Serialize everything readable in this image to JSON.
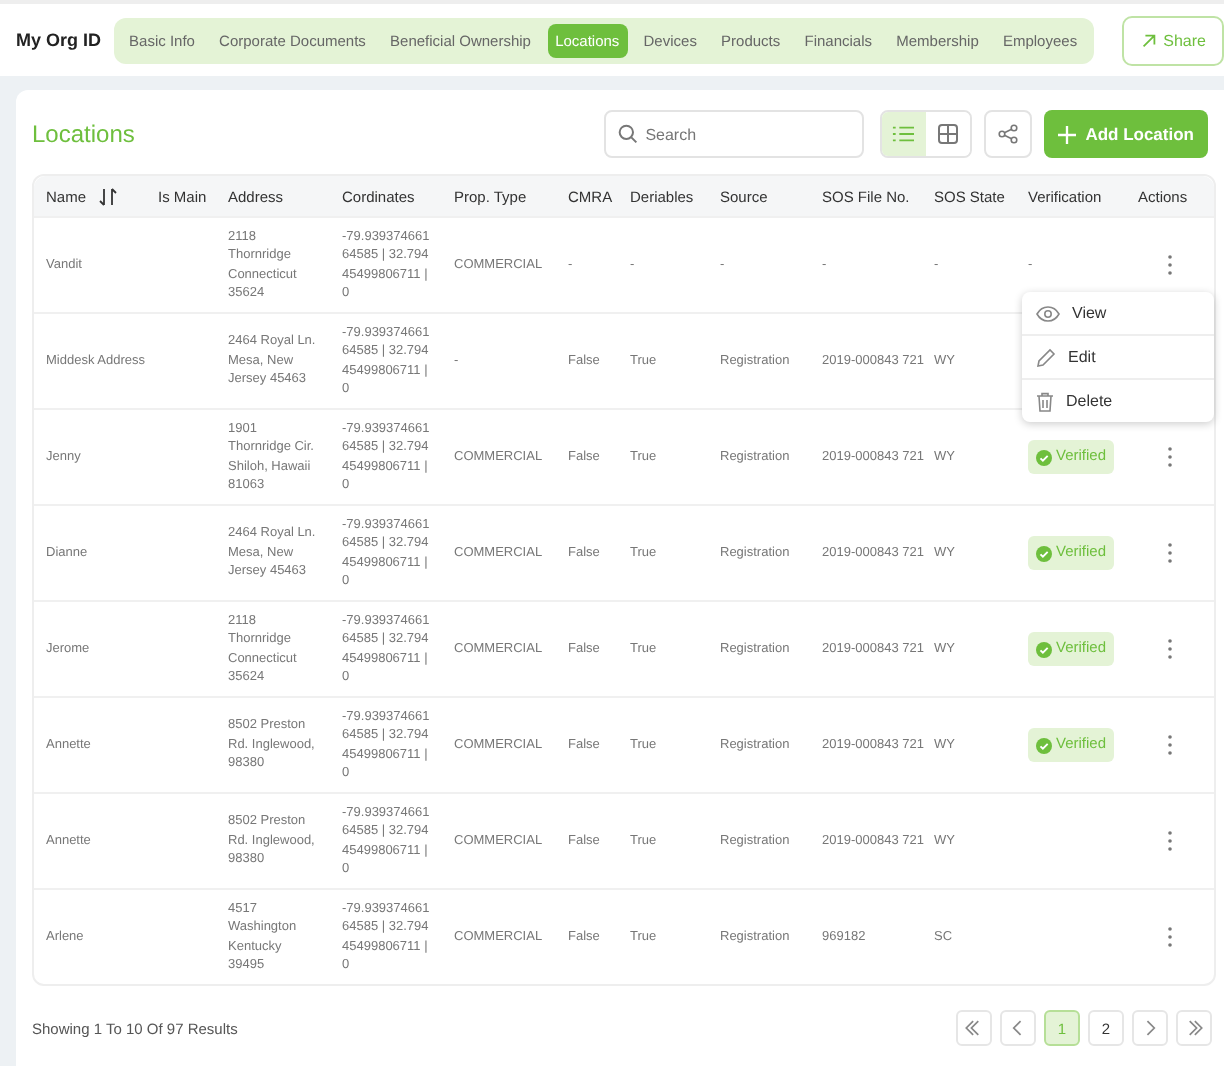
{
  "org_title": "My Org ID",
  "tabs": [
    {
      "label": "Basic Info",
      "selected": false
    },
    {
      "label": "Corporate Documents",
      "selected": false
    },
    {
      "label": "Beneficial Ownership",
      "selected": false
    },
    {
      "label": "Locations",
      "selected": true
    },
    {
      "label": "Devices",
      "selected": false
    },
    {
      "label": "Products",
      "selected": false
    },
    {
      "label": "Financials",
      "selected": false
    },
    {
      "label": "Membership",
      "selected": false
    },
    {
      "label": "Employees",
      "selected": false
    }
  ],
  "share_button": "Share",
  "page_title": "Locations",
  "search": {
    "placeholder": "Search"
  },
  "view_toggle": [
    {
      "kind": "list",
      "selected": true
    },
    {
      "kind": "grid",
      "selected": false
    }
  ],
  "add_button": "Add Location",
  "table": {
    "columns": [
      "Name",
      "Is Main",
      "Address",
      "Cordinates",
      "Prop. Type",
      "CMRA",
      "Deriables",
      "Source",
      "SOS File No.",
      "SOS State",
      "Verification",
      "Actions"
    ],
    "rows": [
      {
        "name": "Vandit",
        "address": "2118 Thornridge Connecticut 35624",
        "coordinates": "-79.93937466164585 | 32.79445499806711 | 0",
        "prop_type": "COMMERCIAL",
        "cmra": "-",
        "deriables": "-",
        "source": "-",
        "sos_file": "-",
        "sos_state": "-",
        "verification": {
          "kind": "text",
          "label": "-"
        },
        "menu": [
          {
            "kind": "view",
            "label": "View"
          },
          {
            "kind": "edit",
            "label": "Edit"
          },
          {
            "kind": "delete",
            "label": "Delete"
          }
        ]
      },
      {
        "name": "Middesk Address",
        "address": "2464 Royal Ln. Mesa, New Jersey 45463",
        "coordinates": "-79.93937466164585 | 32.79445499806711 | 0",
        "prop_type": "-",
        "cmra": "False",
        "deriables": "True",
        "source": "Registration",
        "sos_file": "2019-000843 721",
        "sos_state": "WY"
      },
      {
        "name": "Jenny",
        "address": "1901 Thornridge Cir. Shiloh, Hawaii 81063",
        "coordinates": "-79.93937466164585 | 32.79445499806711 | 0",
        "prop_type": "COMMERCIAL",
        "cmra": "False",
        "deriables": "True",
        "source": "Registration",
        "sos_file": "2019-000843 721",
        "sos_state": "WY",
        "verification": {
          "kind": "badge",
          "label": "Verified"
        }
      },
      {
        "name": "Dianne",
        "address": "2464 Royal Ln. Mesa, New Jersey 45463",
        "coordinates": "-79.93937466164585 | 32.79445499806711 | 0",
        "prop_type": "COMMERCIAL",
        "cmra": "False",
        "deriables": "True",
        "source": "Registration",
        "sos_file": "2019-000843 721",
        "sos_state": "WY",
        "verification": {
          "kind": "badge",
          "label": "Verified"
        }
      },
      {
        "name": "Jerome",
        "address": "2118 Thornridge Connecticut 35624",
        "coordinates": "-79.93937466164585 | 32.79445499806711 | 0",
        "prop_type": "COMMERCIAL",
        "cmra": "False",
        "deriables": "True",
        "source": "Registration",
        "sos_file": "2019-000843 721",
        "sos_state": "WY",
        "verification": {
          "kind": "badge",
          "label": "Verified"
        }
      },
      {
        "name": "Annette",
        "address": "8502 Preston Rd. Inglewood, 98380",
        "coordinates": "-79.93937466164585 | 32.79445499806711 | 0",
        "prop_type": "COMMERCIAL",
        "cmra": "False",
        "deriables": "True",
        "source": "Registration",
        "sos_file": "2019-000843 721",
        "sos_state": "WY",
        "verification": {
          "kind": "badge",
          "label": "Verified"
        }
      },
      {
        "name": "Annette",
        "address": "8502 Preston Rd. Inglewood, 98380",
        "coordinates": "-79.93937466164585 | 32.79445499806711 | 0",
        "prop_type": "COMMERCIAL",
        "cmra": "False",
        "deriables": "True",
        "source": "Registration",
        "sos_file": "2019-000843 721",
        "sos_state": "WY"
      },
      {
        "name": "Arlene",
        "address": "4517 Washington Kentucky 39495",
        "coordinates": "-79.93937466164585 | 32.79445499806711 | 0",
        "prop_type": "COMMERCIAL",
        "cmra": "False",
        "deriables": "True",
        "source": "Registration",
        "sos_file": "969182",
        "sos_state": "SC"
      }
    ]
  },
  "results_text": "Showing 1 To 10 Of 97 Results",
  "pagination": [
    {
      "kind": "first",
      "selected": false
    },
    {
      "kind": "prev",
      "selected": false
    },
    {
      "kind": "page",
      "label": "1",
      "selected": true
    },
    {
      "kind": "page",
      "label": "2",
      "selected": false
    },
    {
      "kind": "next",
      "selected": false
    },
    {
      "kind": "last",
      "selected": false
    }
  ]
}
